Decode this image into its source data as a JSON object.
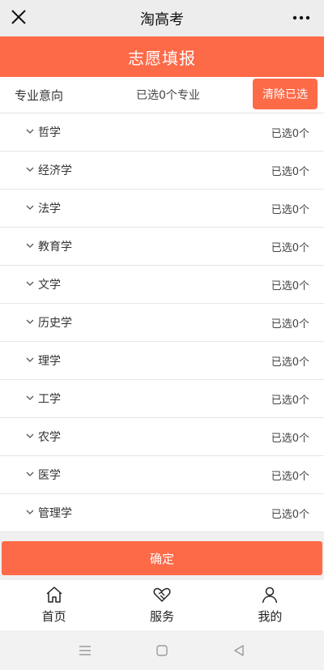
{
  "header": {
    "title": "淘高考",
    "close_icon": "close-icon",
    "more_icon": "more-dots-icon"
  },
  "hero": {
    "title": "志愿填报"
  },
  "filter": {
    "label": "专业意向",
    "selected_count_text": "已选0个专业",
    "clear_button": "清除已选"
  },
  "categories": [
    {
      "name": "哲学",
      "status": "已选0个"
    },
    {
      "name": "经济学",
      "status": "已选0个"
    },
    {
      "name": "法学",
      "status": "已选0个"
    },
    {
      "name": "教育学",
      "status": "已选0个"
    },
    {
      "name": "文学",
      "status": "已选0个"
    },
    {
      "name": "历史学",
      "status": "已选0个"
    },
    {
      "name": "理学",
      "status": "已选0个"
    },
    {
      "name": "工学",
      "status": "已选0个"
    },
    {
      "name": "农学",
      "status": "已选0个"
    },
    {
      "name": "医学",
      "status": "已选0个"
    },
    {
      "name": "管理学",
      "status": "已选0个"
    }
  ],
  "confirm_button": "确定",
  "tabs": [
    {
      "label": "首页",
      "icon": "home-icon"
    },
    {
      "label": "服务",
      "icon": "handshake-icon"
    },
    {
      "label": "我的",
      "icon": "user-icon"
    }
  ],
  "system_nav": [
    "menu-icon",
    "square-home-icon",
    "back-triangle-icon"
  ],
  "colors": {
    "accent": "#fd6a48",
    "topbar_bg": "#ededed"
  }
}
